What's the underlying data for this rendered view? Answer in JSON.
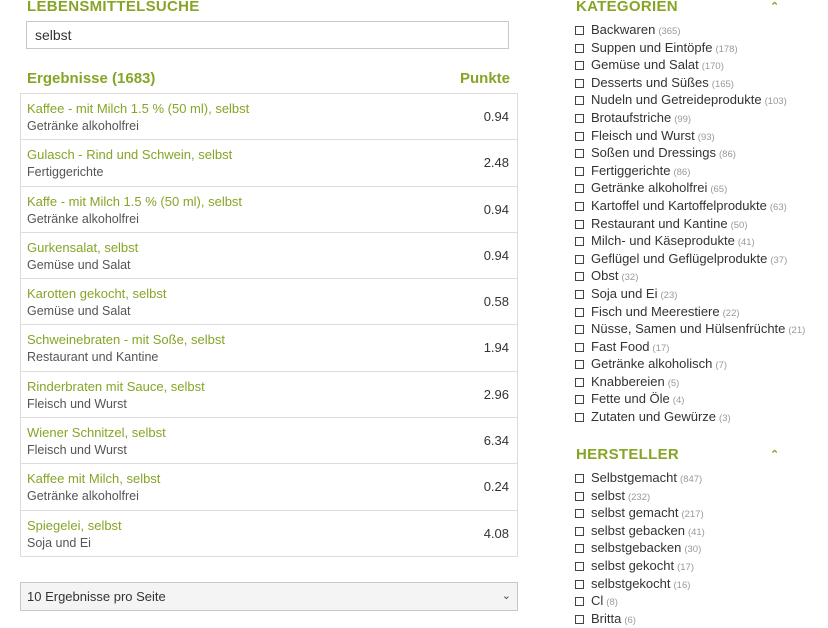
{
  "search": {
    "title": "LEBENSMITTELSUCHE",
    "query": "selbst"
  },
  "results": {
    "title": "Ergebnisse (1683)",
    "points_header": "Punkte",
    "items": [
      {
        "name": "Kaffee - mit Milch 1.5 % (50 ml), selbst",
        "category": "Getränke alkoholfrei",
        "points": "0.94"
      },
      {
        "name": "Gulasch - Rind und Schwein, selbst",
        "category": "Fertiggerichte",
        "points": "2.48"
      },
      {
        "name": "Kaffe - mit Milch 1.5 % (50 ml), selbst",
        "category": "Getränke alkoholfrei",
        "points": "0.94"
      },
      {
        "name": "Gurkensalat, selbst",
        "category": "Gemüse und Salat",
        "points": "0.94"
      },
      {
        "name": "Karotten gekocht, selbst",
        "category": "Gemüse und Salat",
        "points": "0.58"
      },
      {
        "name": "Schweinebraten - mit Soße, selbst",
        "category": "Restaurant und Kantine",
        "points": "1.94"
      },
      {
        "name": "Rinderbraten mit Sauce, selbst",
        "category": "Fleisch und Wurst",
        "points": "2.96"
      },
      {
        "name": "Wiener Schnitzel, selbst",
        "category": "Fleisch und Wurst",
        "points": "6.34"
      },
      {
        "name": "Kaffee mit Milch, selbst",
        "category": "Getränke alkoholfrei",
        "points": "0.24"
      },
      {
        "name": "Spiegelei, selbst",
        "category": "Soja und Ei",
        "points": "4.08"
      }
    ],
    "per_page": "10 Ergebnisse pro Seite"
  },
  "categories": {
    "title": "KATEGORIEN",
    "toggle_icon": "chevron-up-icon",
    "items": [
      {
        "label": "Backwaren",
        "count": "(365)"
      },
      {
        "label": "Suppen und Eintöpfe",
        "count": "(178)"
      },
      {
        "label": "Gemüse und Salat",
        "count": "(170)"
      },
      {
        "label": "Desserts und Süßes",
        "count": "(165)"
      },
      {
        "label": "Nudeln und Getreideprodukte",
        "count": "(103)"
      },
      {
        "label": "Brotaufstriche",
        "count": "(99)"
      },
      {
        "label": "Fleisch und Wurst",
        "count": "(93)"
      },
      {
        "label": "Soßen und Dressings",
        "count": "(86)"
      },
      {
        "label": "Fertiggerichte",
        "count": "(86)"
      },
      {
        "label": "Getränke alkoholfrei",
        "count": "(65)"
      },
      {
        "label": "Kartoffel und Kartoffelprodukte",
        "count": "(63)"
      },
      {
        "label": "Restaurant und Kantine",
        "count": "(50)"
      },
      {
        "label": "Milch- und Käseprodukte",
        "count": "(41)"
      },
      {
        "label": "Geflügel und Geflügelprodukte",
        "count": "(37)"
      },
      {
        "label": "Obst",
        "count": "(32)"
      },
      {
        "label": "Soja und Ei",
        "count": "(23)"
      },
      {
        "label": "Fisch und Meerestiere",
        "count": "(22)"
      },
      {
        "label": "Nüsse, Samen und Hülsenfrüchte",
        "count": "(21)"
      },
      {
        "label": "Fast Food",
        "count": "(17)"
      },
      {
        "label": "Getränke alkoholisch",
        "count": "(7)"
      },
      {
        "label": "Knabbereien",
        "count": "(5)"
      },
      {
        "label": "Fette und Öle",
        "count": "(4)"
      },
      {
        "label": "Zutaten und Gewürze",
        "count": "(3)"
      }
    ]
  },
  "manufacturers": {
    "title": "HERSTELLER",
    "toggle_icon": "chevron-up-icon",
    "items": [
      {
        "label": "Selbstgemacht",
        "count": "(847)"
      },
      {
        "label": "selbst",
        "count": "(232)"
      },
      {
        "label": "selbst gemacht",
        "count": "(217)"
      },
      {
        "label": "selbst gebacken",
        "count": "(41)"
      },
      {
        "label": "selbstgebacken",
        "count": "(30)"
      },
      {
        "label": "selbst gekocht",
        "count": "(17)"
      },
      {
        "label": "selbstgekocht",
        "count": "(16)"
      },
      {
        "label": "Cl",
        "count": "(8)"
      },
      {
        "label": "Britta",
        "count": "(6)"
      }
    ]
  },
  "colors": {
    "accent": "#86a526",
    "text": "#333333",
    "muted": "#999999",
    "border": "#dcdcdc"
  }
}
